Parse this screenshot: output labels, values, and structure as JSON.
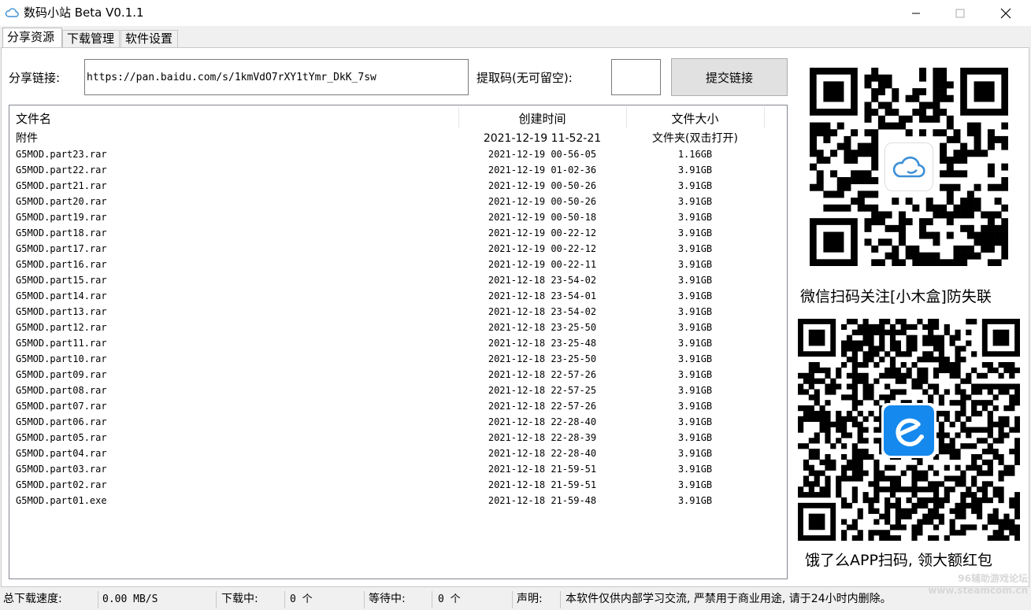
{
  "window": {
    "title": "数码小站 Beta V0.1.1",
    "icon": "cloud-icon",
    "controls": [
      "minimize-icon",
      "maximize-icon",
      "close-icon"
    ]
  },
  "tabs": [
    {
      "label": "分享资源",
      "active": true
    },
    {
      "label": "下载管理",
      "active": false
    },
    {
      "label": "软件设置",
      "active": false
    }
  ],
  "share_form": {
    "link_label": "分享链接:",
    "link_value": "https://pan.baidu.com/s/1kmVdO7rXY1tYmr_DkK_7sw",
    "code_label": "提取码(无可留空):",
    "code_value": "",
    "submit_label": "提交链接"
  },
  "file_list": {
    "columns": [
      "文件名",
      "创建时间",
      "文件大小"
    ],
    "rows": [
      [
        "附件",
        "2021-12-19 11-52-21",
        "文件夹(双击打开)"
      ],
      [
        "G5MOD.part23.rar",
        "2021-12-19 00-56-05",
        "1.16GB"
      ],
      [
        "G5MOD.part22.rar",
        "2021-12-19 01-02-36",
        "3.91GB"
      ],
      [
        "G5MOD.part21.rar",
        "2021-12-19 00-50-26",
        "3.91GB"
      ],
      [
        "G5MOD.part20.rar",
        "2021-12-19 00-50-26",
        "3.91GB"
      ],
      [
        "G5MOD.part19.rar",
        "2021-12-19 00-50-18",
        "3.91GB"
      ],
      [
        "G5MOD.part18.rar",
        "2021-12-19 00-22-12",
        "3.91GB"
      ],
      [
        "G5MOD.part17.rar",
        "2021-12-19 00-22-12",
        "3.91GB"
      ],
      [
        "G5MOD.part16.rar",
        "2021-12-19 00-22-11",
        "3.91GB"
      ],
      [
        "G5MOD.part15.rar",
        "2021-12-18 23-54-02",
        "3.91GB"
      ],
      [
        "G5MOD.part14.rar",
        "2021-12-18 23-54-01",
        "3.91GB"
      ],
      [
        "G5MOD.part13.rar",
        "2021-12-18 23-54-02",
        "3.91GB"
      ],
      [
        "G5MOD.part12.rar",
        "2021-12-18 23-25-50",
        "3.91GB"
      ],
      [
        "G5MOD.part11.rar",
        "2021-12-18 23-25-48",
        "3.91GB"
      ],
      [
        "G5MOD.part10.rar",
        "2021-12-18 23-25-50",
        "3.91GB"
      ],
      [
        "G5MOD.part09.rar",
        "2021-12-18 22-57-26",
        "3.91GB"
      ],
      [
        "G5MOD.part08.rar",
        "2021-12-18 22-57-25",
        "3.91GB"
      ],
      [
        "G5MOD.part07.rar",
        "2021-12-18 22-57-26",
        "3.91GB"
      ],
      [
        "G5MOD.part06.rar",
        "2021-12-18 22-28-40",
        "3.91GB"
      ],
      [
        "G5MOD.part05.rar",
        "2021-12-18 22-28-39",
        "3.91GB"
      ],
      [
        "G5MOD.part04.rar",
        "2021-12-18 22-28-40",
        "3.91GB"
      ],
      [
        "G5MOD.part03.rar",
        "2021-12-18 21-59-51",
        "3.91GB"
      ],
      [
        "G5MOD.part02.rar",
        "2021-12-18 21-59-51",
        "3.91GB"
      ],
      [
        "G5MOD.part01.exe",
        "2021-12-18 21-59-48",
        "3.91GB"
      ]
    ]
  },
  "sidebar": {
    "qr1_caption": "微信扫码关注[小木盒]防失联",
    "qr1_logo": "cloud-icon",
    "qr2_caption": "饿了么APP扫码, 领大额红包",
    "qr2_logo": "eleme-icon"
  },
  "statusbar": {
    "speed_label": "总下载速度:",
    "speed_value": "0.00 MB/S",
    "downloading_label": "下载中:",
    "downloading_value": "0 个",
    "waiting_label": "等待中:",
    "waiting_value": "0 个",
    "notice_label": "声明:",
    "notice_text": "本软件仅供内部学习交流, 严禁用于商业用途, 请于24小时内删除。"
  },
  "watermark": {
    "line1": "96辅助游戏论坛",
    "line2": "www.steamcom.cn"
  },
  "colors": {
    "qr_logo_blue": "#1589ee",
    "cloud_stroke": "#3b8fd6"
  }
}
